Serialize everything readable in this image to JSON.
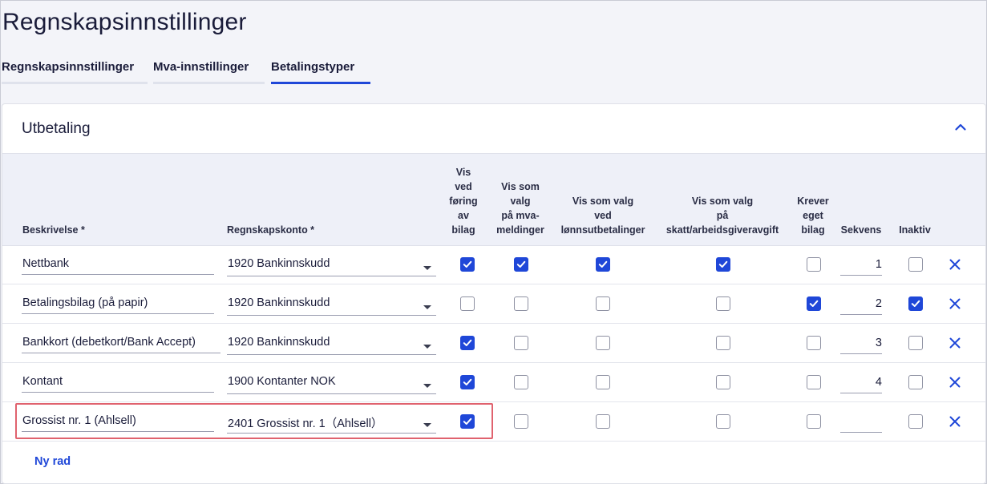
{
  "page": {
    "title": "Regnskapsinnstillinger"
  },
  "tabs": [
    {
      "label": "Regnskapsinnstillinger",
      "active": false
    },
    {
      "label": "Mva-innstillinger",
      "active": false
    },
    {
      "label": "Betalingstyper",
      "active": true
    }
  ],
  "section": {
    "title": "Utbetaling",
    "collapse_icon": "chevron-up-icon"
  },
  "columns": {
    "description": "Beskrivelse *",
    "account": "Regnskapskonto *",
    "show_on_voucher": "Vis\nved\nføring\nav\nbilag",
    "show_vat": "Vis som\nvalg\npå mva-\nmeldinger",
    "show_salary": "Vis som valg\nved\nlønnsutbetalinger",
    "show_tax": "Vis som valg\npå\nskatt/arbeidsgiveravgift",
    "requires_voucher": "Krever\neget\nbilag",
    "sequence": "Sekvens",
    "inactive": "Inaktiv"
  },
  "rows": [
    {
      "description": "Nettbank",
      "account": "1920 Bankinnskudd",
      "show_on_voucher": true,
      "show_vat": true,
      "show_salary": true,
      "show_tax": true,
      "requires_voucher": false,
      "sequence": "1",
      "inactive": false
    },
    {
      "description": "Betalingsbilag (på papir)",
      "account": "1920 Bankinnskudd",
      "show_on_voucher": false,
      "show_vat": false,
      "show_salary": false,
      "show_tax": false,
      "requires_voucher": true,
      "sequence": "2",
      "inactive": true
    },
    {
      "description": "Bankkort (debetkort/Bank Accept)",
      "account": "1920 Bankinnskudd",
      "show_on_voucher": true,
      "show_vat": false,
      "show_salary": false,
      "show_tax": false,
      "requires_voucher": false,
      "sequence": "3",
      "inactive": false
    },
    {
      "description": "Kontant",
      "account": "1900 Kontanter NOK",
      "show_on_voucher": true,
      "show_vat": false,
      "show_salary": false,
      "show_tax": false,
      "requires_voucher": false,
      "sequence": "4",
      "inactive": false
    },
    {
      "description": "Grossist nr. 1 (Ahlsell)",
      "account": "2401 Grossist nr. 1（Ahlsell）",
      "show_on_voucher": true,
      "show_vat": false,
      "show_salary": false,
      "show_tax": false,
      "requires_voucher": false,
      "sequence": "",
      "inactive": false
    }
  ],
  "actions": {
    "new_row": "Ny rad",
    "delete_icon": "close-icon"
  },
  "colors": {
    "accent": "#1f47d8",
    "highlight": "#e0626e",
    "header_bg": "#eef0f8"
  }
}
